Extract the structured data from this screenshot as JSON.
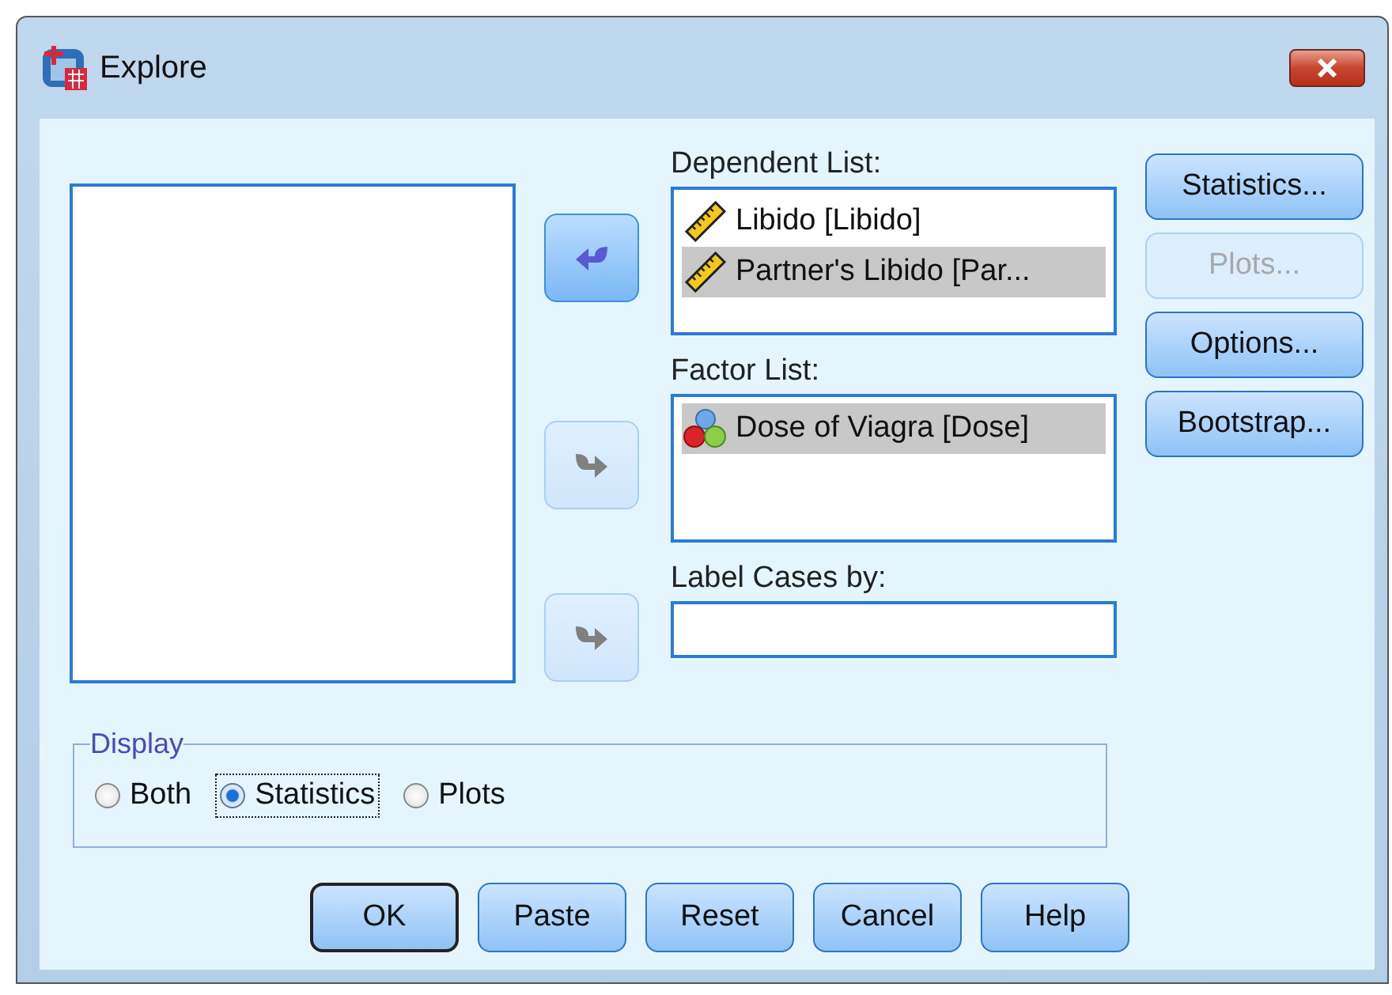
{
  "window": {
    "title": "Explore"
  },
  "move_buttons": [
    {
      "disabled": false,
      "kind": "left"
    },
    {
      "disabled": true,
      "kind": "right"
    },
    {
      "disabled": true,
      "kind": "right"
    }
  ],
  "dependent_list": {
    "label": "Dependent List:",
    "items": [
      {
        "text": "Libido [Libido]",
        "kind": "scale",
        "selected": false
      },
      {
        "text": "Partner's Libido [Par...",
        "kind": "scale",
        "selected": true
      }
    ]
  },
  "factor_list": {
    "label": "Factor List:",
    "items": [
      {
        "text": "Dose of Viagra [Dose]",
        "kind": "nominal",
        "selected": true
      }
    ]
  },
  "label_cases": {
    "label": "Label Cases by:"
  },
  "side_buttons": [
    {
      "label": "Statistics...",
      "disabled": false
    },
    {
      "label": "Plots...",
      "disabled": true
    },
    {
      "label": "Options...",
      "disabled": false
    },
    {
      "label": "Bootstrap...",
      "disabled": false
    }
  ],
  "display": {
    "title": "Display",
    "options": [
      {
        "label": "Both",
        "selected": false,
        "focused": false
      },
      {
        "label": "Statistics",
        "selected": true,
        "focused": true
      },
      {
        "label": "Plots",
        "selected": false,
        "focused": false
      }
    ]
  },
  "buttons": [
    {
      "label": "OK",
      "default": true
    },
    {
      "label": "Paste",
      "default": false
    },
    {
      "label": "Reset",
      "default": false
    },
    {
      "label": "Cancel",
      "default": false
    },
    {
      "label": "Help",
      "default": false
    }
  ]
}
